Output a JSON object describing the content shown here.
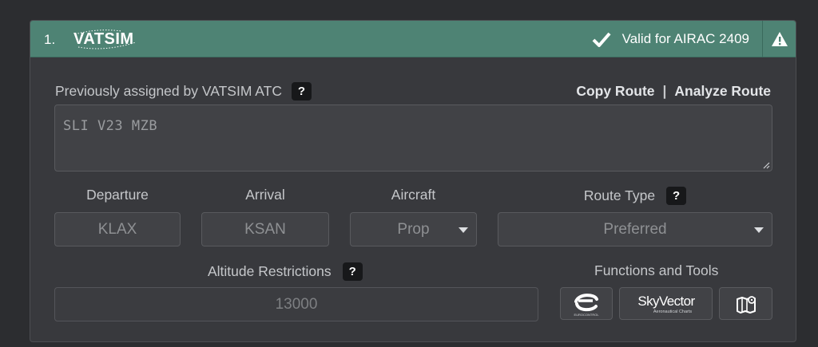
{
  "header": {
    "index": "1.",
    "logo_text": "VATSIM",
    "valid_text": "Valid for AIRAC 2409",
    "icons": {
      "check": "check-icon",
      "warning": "warning-icon"
    },
    "color": "#4e8374"
  },
  "route": {
    "label": "Previously assigned by VATSIM ATC",
    "help": "?",
    "value": "SLI V23 MZB",
    "links": {
      "copy": "Copy Route",
      "separator": "|",
      "analyze": "Analyze Route"
    }
  },
  "fields": {
    "departure": {
      "label": "Departure",
      "value": "KLAX"
    },
    "arrival": {
      "label": "Arrival",
      "value": "KSAN"
    },
    "aircraft": {
      "label": "Aircraft",
      "value": "Prop"
    },
    "route_type": {
      "label": "Route Type",
      "help": "?",
      "value": "Preferred"
    }
  },
  "altitude": {
    "label": "Altitude Restrictions",
    "help": "?",
    "value": "13000"
  },
  "tools": {
    "label": "Functions and Tools",
    "eurocontrol_caption": "EUROCONTROL",
    "skyvector_name": "SkyVector",
    "skyvector_caption": "Aeronautical Charts",
    "map_icon": "map-icon"
  }
}
